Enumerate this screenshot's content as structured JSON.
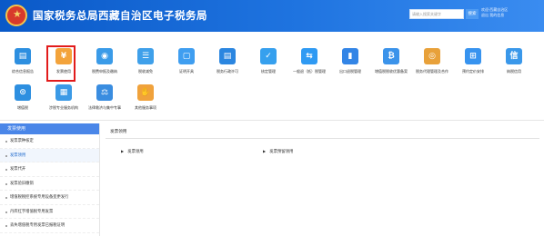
{
  "header": {
    "title": "国家税务总局西藏自治区电子税务局",
    "search_placeholder": "请输入搜索关键字",
    "search_button": "搜索",
    "user_line1": "欢迎·西藏自治区",
    "user_line2": "退出  我的信息"
  },
  "tiles": [
    {
      "label": "综合信息报告",
      "icon": "report-icon",
      "color": "#2d8fe0"
    },
    {
      "label": "发票使用",
      "icon": "invoice-icon",
      "color": "#f3a33b"
    },
    {
      "label": "税费申报及缴纳",
      "icon": "tax-declare-icon",
      "color": "#3a9be8"
    },
    {
      "label": "税收减免",
      "icon": "tax-relief-icon",
      "color": "#3fa0ea"
    },
    {
      "label": "证明开具",
      "icon": "certificate-icon",
      "color": "#3f9ef0"
    },
    {
      "label": "税务行政许可",
      "icon": "permit-icon",
      "color": "#2b86e0"
    },
    {
      "label": "核定管理",
      "icon": "approval-icon",
      "color": "#36a0ee"
    },
    {
      "label": "一般退（抵）税管理",
      "icon": "refund-icon",
      "color": "#2f9af3"
    },
    {
      "label": "出口退税管理",
      "icon": "export-refund-icon",
      "color": "#3385e6"
    },
    {
      "label": "增值税税收优惠备案",
      "icon": "vat-filing-icon",
      "color": "#3b93ea"
    },
    {
      "label": "税务代理管理及合作",
      "icon": "agent-icon",
      "color": "#e8a13a"
    },
    {
      "label": "预约定价安排",
      "icon": "pricing-icon",
      "color": "#3793ef"
    },
    {
      "label": "纳税信用",
      "icon": "credit-icon",
      "color": "#3a98ea"
    },
    {
      "label": "增值税",
      "icon": "vat-icon",
      "color": "#2d8fe0"
    },
    {
      "label": "涉税专业服务机构",
      "icon": "service-org-icon",
      "color": "#3b9ae6"
    },
    {
      "label": "法律救济与集中专事",
      "icon": "legal-icon",
      "color": "#3a8de0"
    },
    {
      "label": "其他服务事项",
      "icon": "handshake-icon",
      "color": "#f0a23c"
    }
  ],
  "left_panel": {
    "heading": "发票使用",
    "items": [
      "发票票种核定",
      "发票领用",
      "发票代开",
      "发票验旧缴销",
      "增值税税控系统专用设备变更发行",
      "丹库红字增值税专用发票",
      "丢失增值税专用发票已报税证明"
    ]
  },
  "content": {
    "crumb": "发票领用",
    "sub_left": "发票领用",
    "sub_right": "发票预留领用"
  }
}
